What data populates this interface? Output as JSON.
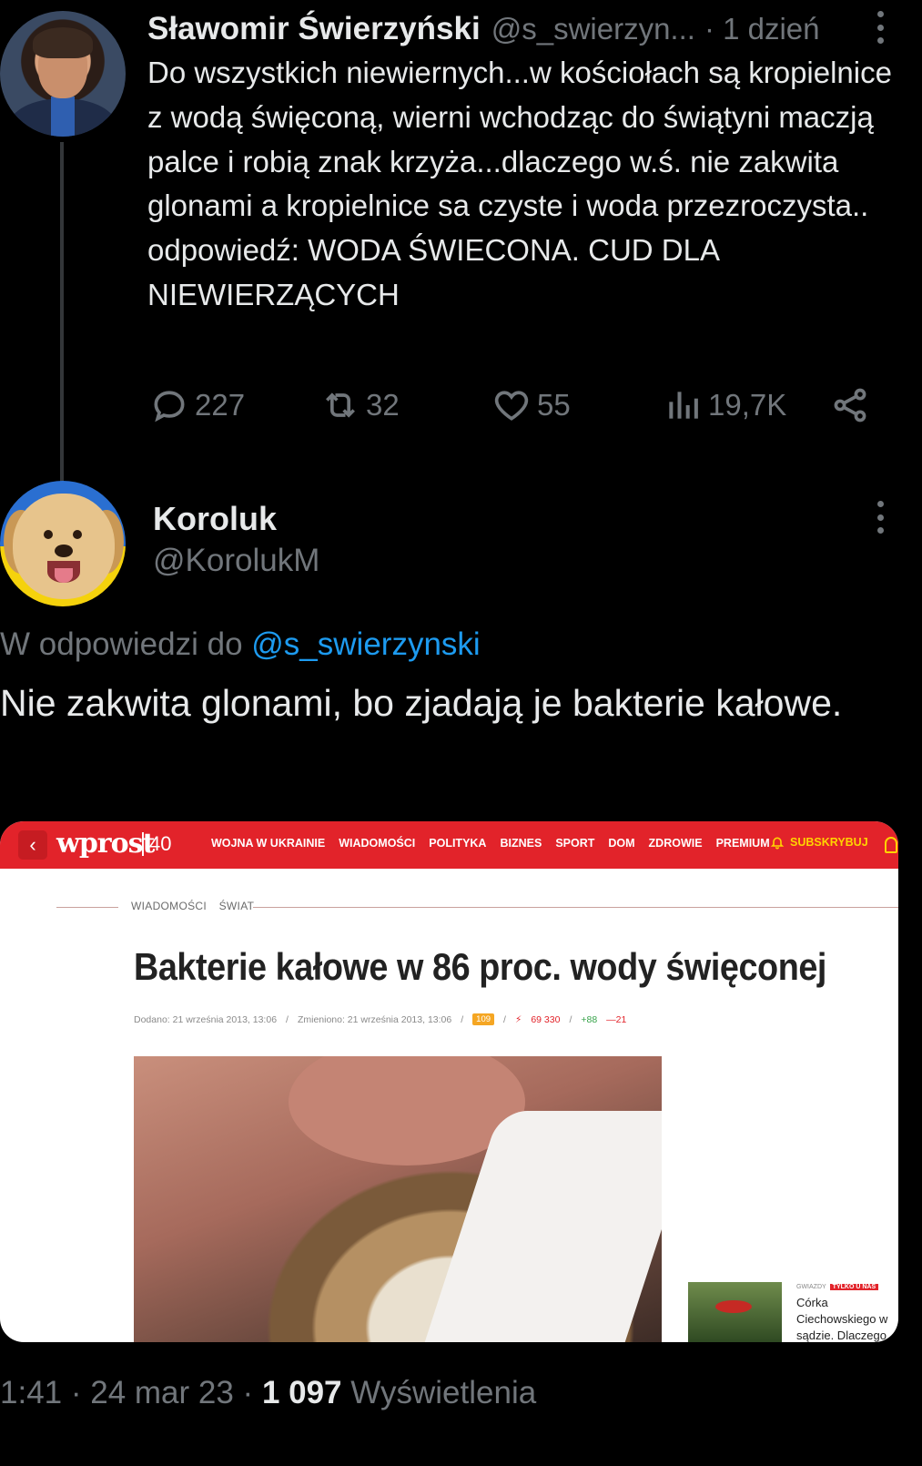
{
  "tweet": {
    "author_name": "Sławomir Świerzyński",
    "author_handle": "@s_swierzyn...",
    "time": "· 1 dzień",
    "text": "Do wszystkich niewiernych...w kościołach są kropielnice z wodą święconą, wierni wchodząc do świątyni maczją palce i robią znak krzyża...dlaczego w.ś. nie zakwita glonami a kropielnice sa czyste i woda przezroczysta.. odpowiedź: WODA ŚWIECONA. CUD DLA NIEWIERZĄCYCH",
    "replies": "227",
    "retweets": "32",
    "likes": "55",
    "views": "19,7K"
  },
  "reply": {
    "author_name": "Koroluk",
    "author_handle": "@KorolukM",
    "reply_to_prefix": "W odpowiedzi do",
    "reply_to_mention": "@s_swierzynski",
    "text": "Nie zakwita glonami, bo zjadają je bakterie kałowe.",
    "timestamp": "1:41 · 24 mar 23 ·",
    "views_count": "1 097",
    "views_label": "Wyświetlenia"
  },
  "embedded_article": {
    "logo": "wprost",
    "logo_number": "40",
    "back_icon": "chevron-left-icon",
    "menu": [
      "WOJNA W UKRAINIE",
      "WIADOMOŚCI",
      "POLITYKA",
      "BIZNES",
      "SPORT",
      "DOM",
      "ZDROWIE",
      "PREMIUM"
    ],
    "subscribe": "SUBSKRYBUJ",
    "breadcrumbs": "WIADOMOŚCI ŚWIAT",
    "title": "Bakterie kałowe w 86 proc. wody święconej",
    "added": "Dodano: 21 września 2013, 13:06",
    "modified": "Zmieniono: 21 września 2013, 13:06",
    "comments_badge": "109",
    "views": "69 330",
    "plus": "+88",
    "minus": "—21",
    "side_category": "GWIAZDY",
    "side_tag": "TYLKO U NAS",
    "side_text": "Córka Ciechowskiego w sądzie. Dlaczego nie uwzględniono",
    "colors": {
      "brand": "#e2232a",
      "subscribe": "#ffd400"
    }
  },
  "colors": {
    "background": "#000000",
    "text": "#e7e9ea",
    "muted": "#71767b",
    "link": "#1d9bf0"
  }
}
